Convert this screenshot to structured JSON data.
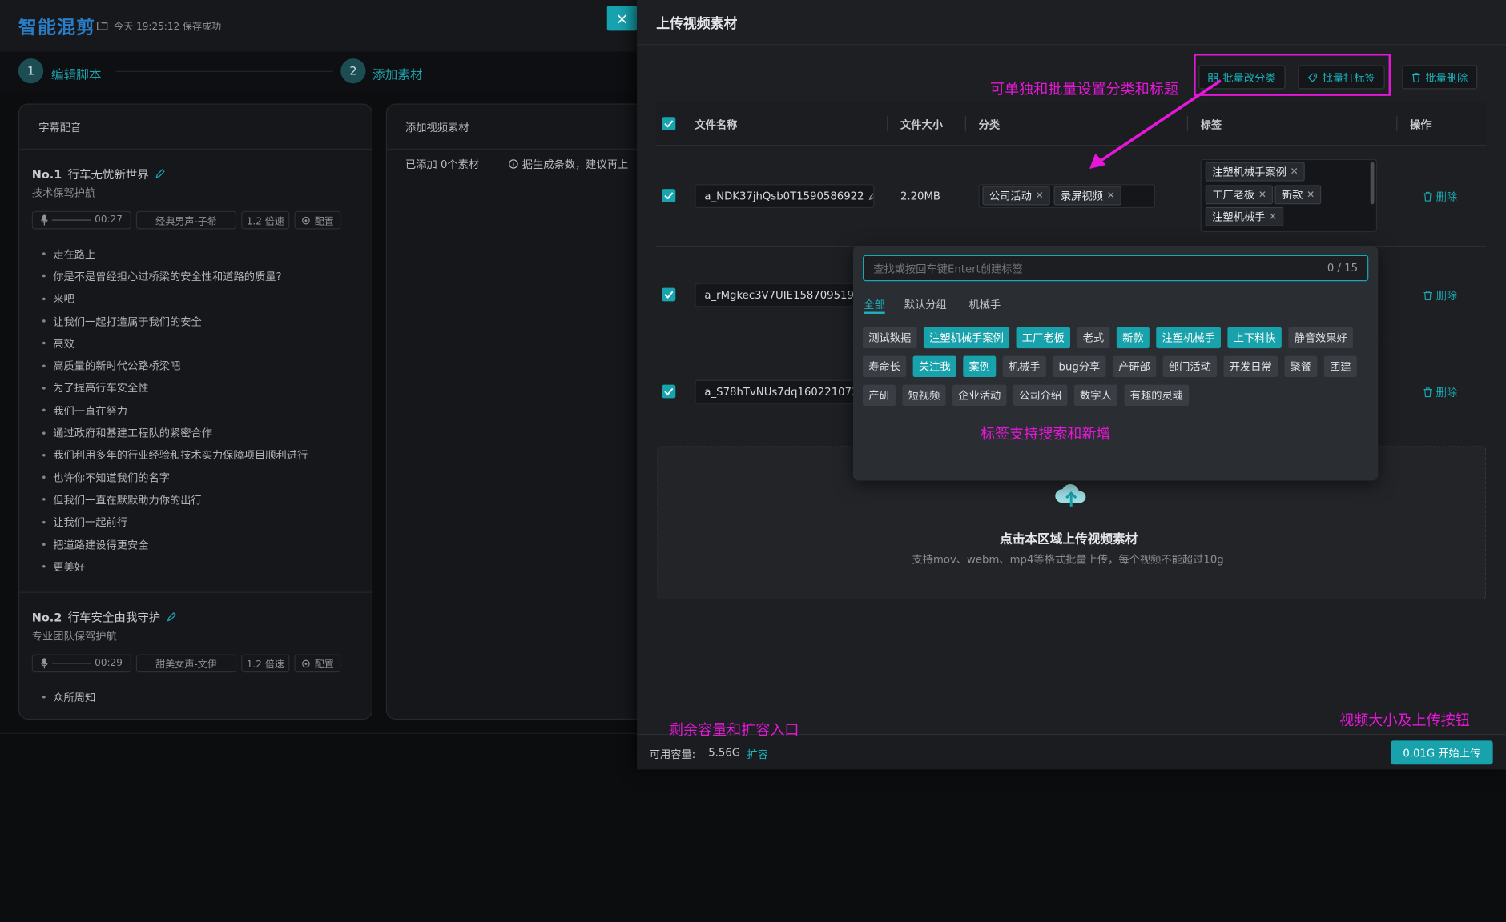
{
  "app": {
    "logo": "智能混剪",
    "save_status": "今天 19:25:12 保存成功"
  },
  "steps": [
    {
      "num": "1",
      "label": "编辑脚本"
    },
    {
      "num": "2",
      "label": "添加素材"
    }
  ],
  "subtitle_card": {
    "title": "字幕配音",
    "sections": [
      {
        "no": "No.1",
        "name": "行车无忧新世界",
        "subtitle": "技术保驾护航",
        "duration": "00:27",
        "voice": "经典男声-子希",
        "speed": "1.2 倍速",
        "config": "配置",
        "lines": [
          "走在路上",
          "你是不是曾经担心过桥梁的安全性和道路的质量?",
          "来吧",
          "让我们一起打造属于我们的安全",
          "高效",
          "高质量的新时代公路桥梁吧",
          "为了提高行车安全性",
          "我们一直在努力",
          "通过政府和基建工程队的紧密合作",
          "我们利用多年的行业经验和技术实力保障项目顺利进行",
          "也许你不知道我们的名字",
          "但我们一直在默默助力你的出行",
          "让我们一起前行",
          "把道路建设得更安全",
          "更美好"
        ]
      },
      {
        "no": "No.2",
        "name": "行车安全由我守护",
        "subtitle": "专业团队保驾护航",
        "duration": "00:29",
        "voice": "甜美女声-文伊",
        "speed": "1.2 倍速",
        "config": "配置",
        "lines": [
          "众所周知"
        ]
      }
    ]
  },
  "video_card": {
    "title": "添加视频素材",
    "added": "已添加 0个素材",
    "hint": "据生成条数，建议再上"
  },
  "dialog": {
    "close": "×",
    "title": "上传视频素材",
    "buttons": {
      "batch_category": "批量改分类",
      "batch_tag": "批量打标签",
      "batch_delete": "批量删除"
    },
    "columns": {
      "name": "文件名称",
      "size": "文件大小",
      "category": "分类",
      "tags": "标签",
      "action": "操作"
    },
    "rows": [
      {
        "name": "a_NDK37jhQsb0T1590586922",
        "size": "2.20MB",
        "categories": [
          "公司活动",
          "录屏视频"
        ],
        "tags": [
          "注塑机械手案例",
          "工厂老板",
          "新款",
          "注塑机械手"
        ],
        "action": "删除"
      },
      {
        "name": "a_rMgkec3V7UIE1587095197_",
        "action": "删除"
      },
      {
        "name": "a_S78hTvNUs7dq1602210733",
        "action": "删除"
      }
    ],
    "tag_popover": {
      "placeholder": "查找或按回车键Entert创建标签",
      "count": "0 / 15",
      "tabs": [
        "全部",
        "默认分组",
        "机械手"
      ],
      "tags": [
        {
          "label": "测试数据",
          "selected": false
        },
        {
          "label": "注塑机械手案例",
          "selected": true
        },
        {
          "label": "工厂老板",
          "selected": true
        },
        {
          "label": "老式",
          "selected": false
        },
        {
          "label": "新款",
          "selected": true
        },
        {
          "label": "注塑机械手",
          "selected": true
        },
        {
          "label": "上下料快",
          "selected": true
        },
        {
          "label": "静音效果好",
          "selected": false
        },
        {
          "label": "寿命长",
          "selected": false
        },
        {
          "label": "关注我",
          "selected": true
        },
        {
          "label": "案例",
          "selected": true
        },
        {
          "label": "机械手",
          "selected": false
        },
        {
          "label": "bug分享",
          "selected": false
        },
        {
          "label": "产研部",
          "selected": false
        },
        {
          "label": "部门活动",
          "selected": false
        },
        {
          "label": "开发日常",
          "selected": false
        },
        {
          "label": "聚餐",
          "selected": false
        },
        {
          "label": "团建",
          "selected": false
        },
        {
          "label": "产研",
          "selected": false
        },
        {
          "label": "短视频",
          "selected": false
        },
        {
          "label": "企业活动",
          "selected": false
        },
        {
          "label": "公司介绍",
          "selected": false
        },
        {
          "label": "数字人",
          "selected": false
        },
        {
          "label": "有趣的灵魂",
          "selected": false
        }
      ]
    },
    "upload": {
      "title": "点击本区域上传视频素材",
      "hint": "支持mov、webm、mp4等格式批量上传，每个视频不能超过10g"
    },
    "footer": {
      "capacity_label": "可用容量:",
      "capacity_value": "5.56G",
      "expand": "扩容",
      "upload_button": "0.01G 开始上传"
    }
  },
  "annotations": {
    "batch": "可单独和批量设置分类和标题",
    "tags": "标签支持搜索和新增",
    "capacity": "剩余容量和扩容入口",
    "upload": "视频大小及上传按钮"
  },
  "colors": {
    "accent": "#18a2ac",
    "annotation": "#e617d8"
  }
}
